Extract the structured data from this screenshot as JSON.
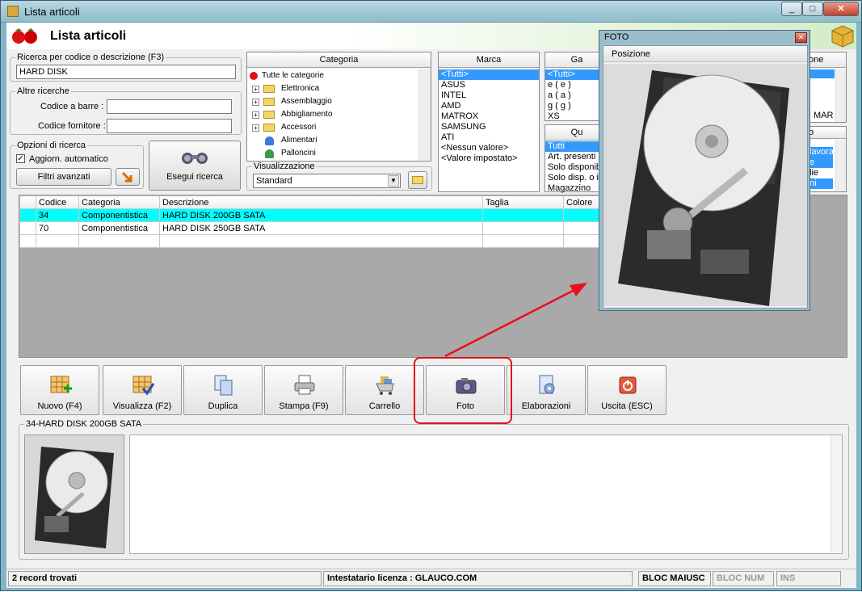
{
  "window": {
    "title": "Lista articoli",
    "btn_min": "_",
    "btn_max": "□",
    "btn_close": "✕"
  },
  "header": {
    "title": "Lista articoli"
  },
  "search": {
    "legend": "Ricerca per codice o descrizione (F3)",
    "value": "HARD DISK"
  },
  "other": {
    "legend": "Altre ricerche",
    "barcode_label": "Codice a barre :",
    "barcode_value": "",
    "supplier_label": "Codice fornitore :",
    "supplier_value": ""
  },
  "options": {
    "legend": "Opzioni di ricerca",
    "auto_label": "Aggiorn. automatico",
    "auto_checked": true,
    "advanced_label": "Filtri avanzati"
  },
  "search_button": "Esegui ricerca",
  "category": {
    "header": "Categoria",
    "items": [
      "Tutte le categorie",
      "Elettronica",
      "Assemblaggio",
      "Abbigliamento",
      "Accessori",
      "Alimentari",
      "Palloncini"
    ],
    "view_legend": "Visualizzazione",
    "view_value": "Standard"
  },
  "brand": {
    "header": "Marca",
    "items": [
      "<Tutti>",
      "ASUS",
      "INTEL",
      "AMD",
      "MATROX",
      "SAMSUNG",
      "ATI",
      "<Nessun valore>",
      "<Valore impostato>"
    ]
  },
  "size": {
    "header": "Ga",
    "items": [
      "<Tutti>",
      "e ( e )",
      "a ( a )",
      "g ( g )",
      "XS"
    ]
  },
  "qty": {
    "header": "Qu",
    "items": [
      "Tutti",
      "Art. presenti a",
      "Solo disponibi",
      "Solo disp. o in",
      "Magazzino"
    ]
  },
  "right_panel": {
    "header": "one",
    "mar": "MAR",
    "small_header": "o",
    "items": [
      "lavora",
      "e",
      "lie",
      "ni"
    ]
  },
  "grid": {
    "columns": [
      "",
      "Codice",
      "Categoria",
      "Descrizione",
      "Taglia",
      "Colore"
    ],
    "rows": [
      [
        "",
        "34",
        "Componentistica",
        "HARD DISK 200GB SATA",
        "",
        ""
      ],
      [
        "",
        "70",
        "Componentistica",
        "HARD DISK 250GB SATA",
        "",
        ""
      ]
    ]
  },
  "toolbar": [
    "Nuovo (F4)",
    "Visualizza (F2)",
    "Duplica",
    "Stampa (F9)",
    "Carrello",
    "Foto",
    "Elaborazioni",
    "Uscita (ESC)"
  ],
  "detail": {
    "legend": "34-HARD DISK 200GB SATA",
    "notes": ""
  },
  "status": {
    "records": "2 record trovati",
    "license": "Intestatario licenza : GLAUCO.COM",
    "caps": "BLOC MAIUSC",
    "num": "BLOC NUM",
    "ins": "INS"
  },
  "foto_window": {
    "title": "FOTO",
    "menu": "Posizione",
    "close": "✕"
  }
}
